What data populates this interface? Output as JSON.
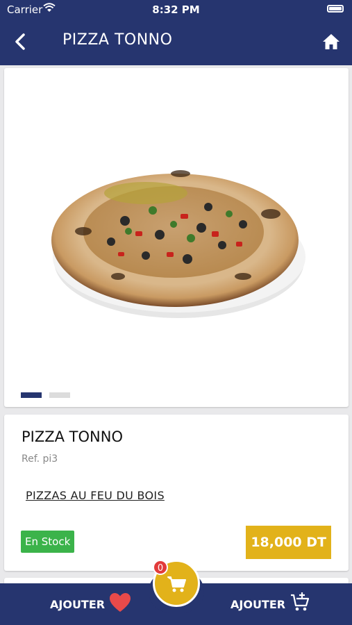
{
  "status_bar": {
    "carrier": "Carrier",
    "time": "8:32 PM"
  },
  "header": {
    "title": "PIZZA TONNO"
  },
  "gallery": {
    "image_count": 2,
    "active_index": 0
  },
  "product": {
    "name": "PIZZA TONNO",
    "ref": "Ref. pi3",
    "category": "PIZZAS AU FEU DU BOIS",
    "stock": "En Stock",
    "price": "18,000 DT"
  },
  "bottom_bar": {
    "favorite_label": "AJOUTER",
    "cart_label": "AJOUTER",
    "cart_count": "0"
  },
  "colors": {
    "primary": "#26356f",
    "accent": "#e2b21a",
    "stock_green": "#3bb34a",
    "heart_red": "#e84a4a"
  },
  "icons": [
    "back-chevron-icon",
    "home-icon",
    "heart-icon",
    "add-to-cart-icon",
    "cart-icon",
    "wifi-icon",
    "battery-icon"
  ]
}
